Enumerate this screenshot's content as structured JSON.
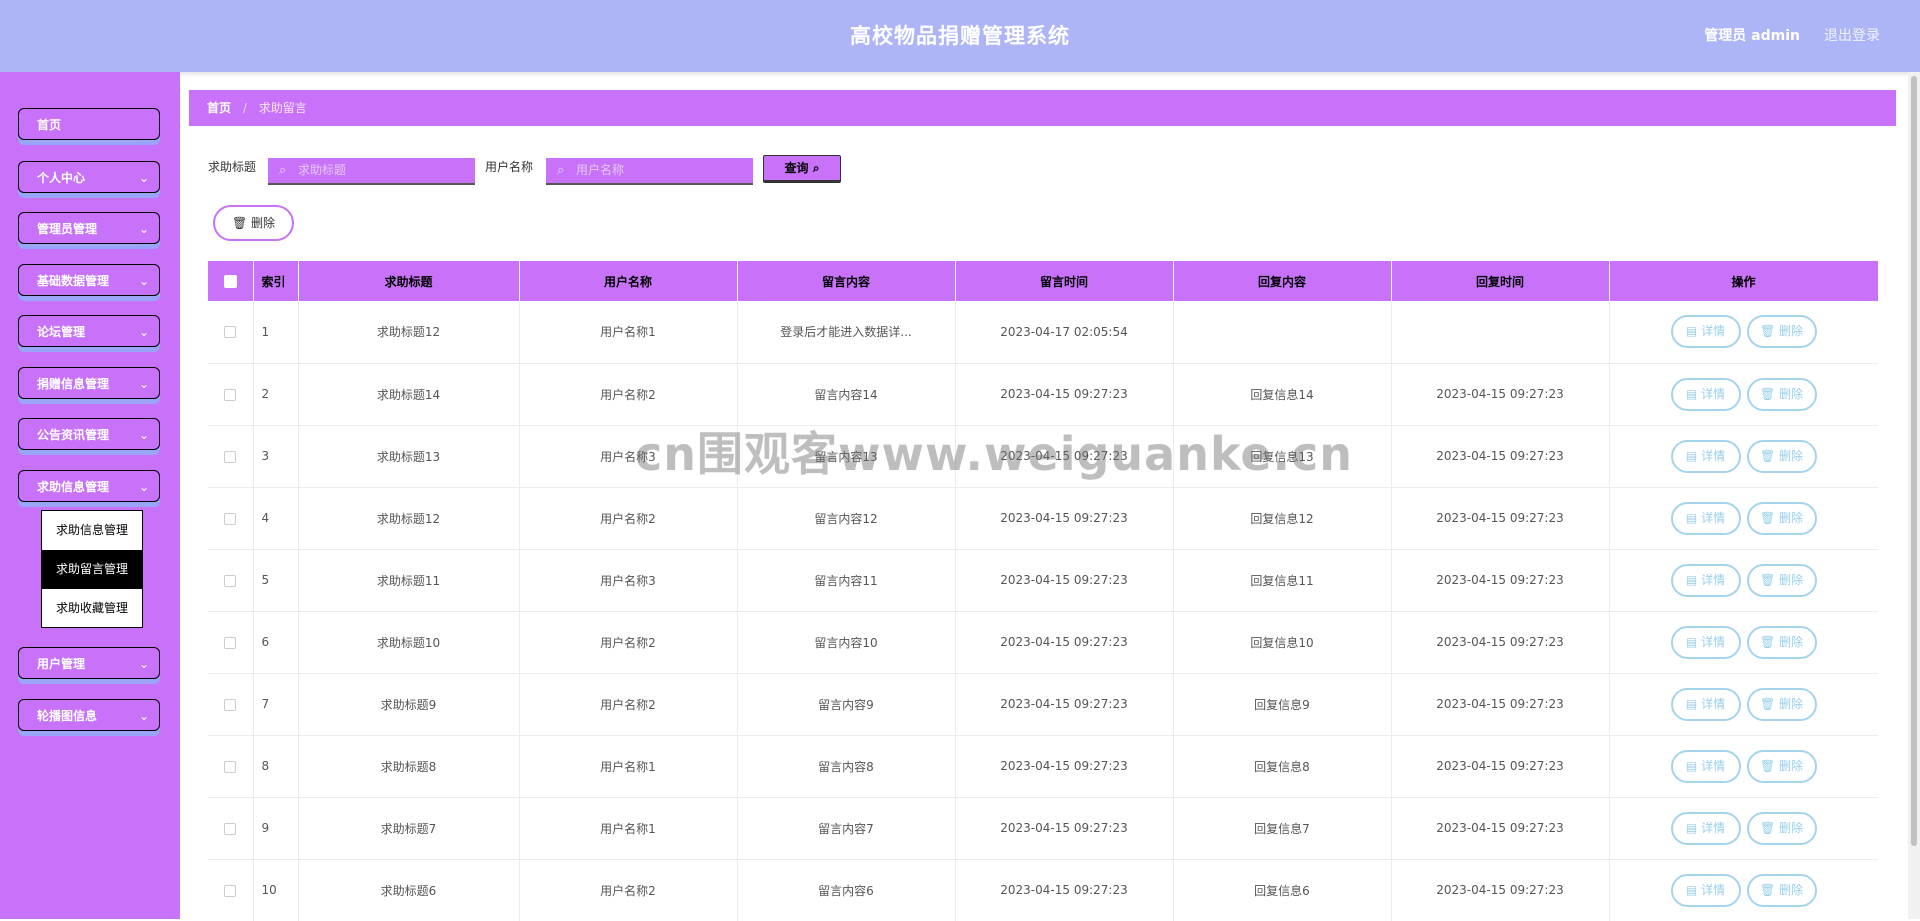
{
  "header": {
    "title": "高校物品捐赠管理系统",
    "admin_label": "管理员 admin",
    "logout_label": "退出登录"
  },
  "sidebar": {
    "items": [
      {
        "label": "首页",
        "has_children": false
      },
      {
        "label": "个人中心",
        "has_children": true
      },
      {
        "label": "管理员管理",
        "has_children": true
      },
      {
        "label": "基础数据管理",
        "has_children": true
      },
      {
        "label": "论坛管理",
        "has_children": true
      },
      {
        "label": "捐赠信息管理",
        "has_children": true
      },
      {
        "label": "公告资讯管理",
        "has_children": true
      },
      {
        "label": "求助信息管理",
        "has_children": true
      },
      {
        "label": "用户管理",
        "has_children": true
      },
      {
        "label": "轮播图信息",
        "has_children": true
      }
    ],
    "submenu": [
      "求助信息管理",
      "求助留言管理",
      "求助收藏管理"
    ],
    "submenu_active": 1
  },
  "breadcrumb": {
    "home": "首页",
    "current": "求助留言"
  },
  "search": {
    "title_label": "求助标题",
    "title_placeholder": "求助标题",
    "user_label": "用户名称",
    "user_placeholder": "用户名称",
    "query_label": "查询"
  },
  "toolbar": {
    "delete_label": "删除"
  },
  "table": {
    "headers": [
      "索引",
      "求助标题",
      "用户名称",
      "留言内容",
      "留言时间",
      "回复内容",
      "回复时间",
      "操作"
    ],
    "detail_label": "详情",
    "delete_label": "删除",
    "rows": [
      {
        "index": "1",
        "title": "求助标题12",
        "user": "用户名称1",
        "content": "登录后才能进入数据详...",
        "time": "2023-04-17 02:05:54",
        "reply": "",
        "reply_time": ""
      },
      {
        "index": "2",
        "title": "求助标题14",
        "user": "用户名称2",
        "content": "留言内容14",
        "time": "2023-04-15 09:27:23",
        "reply": "回复信息14",
        "reply_time": "2023-04-15 09:27:23"
      },
      {
        "index": "3",
        "title": "求助标题13",
        "user": "用户名称3",
        "content": "留言内容13",
        "time": "2023-04-15 09:27:23",
        "reply": "回复信息13",
        "reply_time": "2023-04-15 09:27:23"
      },
      {
        "index": "4",
        "title": "求助标题12",
        "user": "用户名称2",
        "content": "留言内容12",
        "time": "2023-04-15 09:27:23",
        "reply": "回复信息12",
        "reply_time": "2023-04-15 09:27:23"
      },
      {
        "index": "5",
        "title": "求助标题11",
        "user": "用户名称3",
        "content": "留言内容11",
        "time": "2023-04-15 09:27:23",
        "reply": "回复信息11",
        "reply_time": "2023-04-15 09:27:23"
      },
      {
        "index": "6",
        "title": "求助标题10",
        "user": "用户名称2",
        "content": "留言内容10",
        "time": "2023-04-15 09:27:23",
        "reply": "回复信息10",
        "reply_time": "2023-04-15 09:27:23"
      },
      {
        "index": "7",
        "title": "求助标题9",
        "user": "用户名称2",
        "content": "留言内容9",
        "time": "2023-04-15 09:27:23",
        "reply": "回复信息9",
        "reply_time": "2023-04-15 09:27:23"
      },
      {
        "index": "8",
        "title": "求助标题8",
        "user": "用户名称1",
        "content": "留言内容8",
        "time": "2023-04-15 09:27:23",
        "reply": "回复信息8",
        "reply_time": "2023-04-15 09:27:23"
      },
      {
        "index": "9",
        "title": "求助标题7",
        "user": "用户名称1",
        "content": "留言内容7",
        "time": "2023-04-15 09:27:23",
        "reply": "回复信息7",
        "reply_time": "2023-04-15 09:27:23"
      },
      {
        "index": "10",
        "title": "求助标题6",
        "user": "用户名称2",
        "content": "留言内容6",
        "time": "2023-04-15 09:27:23",
        "reply": "回复信息6",
        "reply_time": "2023-04-15 09:27:23"
      }
    ]
  },
  "watermark": "cn围观客www.weiguanke.cn",
  "colors": {
    "header_bg": "#adb5f6",
    "accent": "#c872fa",
    "action_border": "#a4d4ec"
  }
}
